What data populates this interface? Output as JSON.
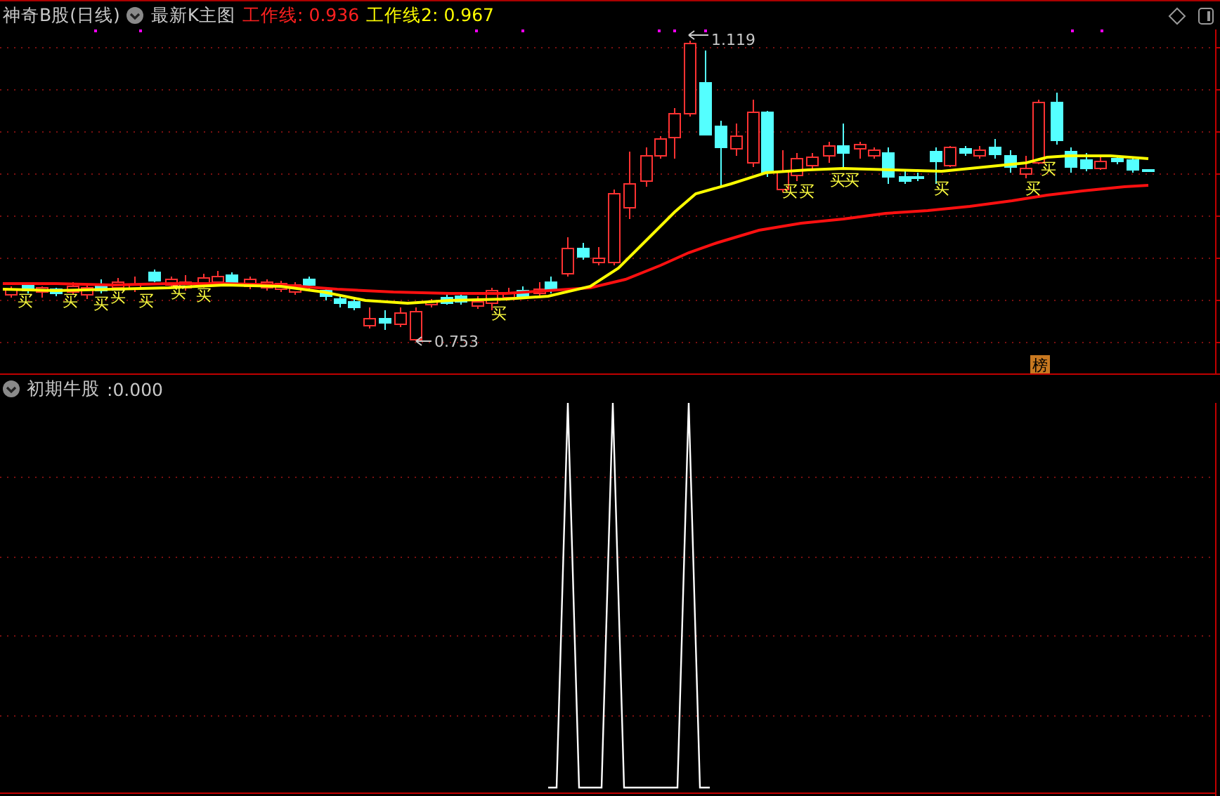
{
  "header": {
    "title": "神奇B股(日线)",
    "indicator": "最新K主图",
    "lines": [
      {
        "label": "工作线:",
        "value": "0.936",
        "color": "#ff2020"
      },
      {
        "label": "工作线2:",
        "value": "0.967",
        "color": "#ffff00"
      }
    ]
  },
  "price_chart": {
    "high_label": "1.119",
    "low_label": "0.753",
    "badge": "榜",
    "signals": [
      {
        "label": "买"
      },
      {
        "label": "买"
      },
      {
        "label": "买"
      },
      {
        "label": "买"
      },
      {
        "label": "买"
      },
      {
        "label": "买"
      },
      {
        "label": "买"
      },
      {
        "label": "买"
      },
      {
        "label": "买"
      },
      {
        "label": "买"
      },
      {
        "label": "买"
      },
      {
        "label": "买"
      },
      {
        "label": "买"
      },
      {
        "label": "买"
      },
      {
        "label": "买"
      }
    ]
  },
  "indicator_panel": {
    "title": "初期牛股",
    "value": ":0.000"
  }
}
